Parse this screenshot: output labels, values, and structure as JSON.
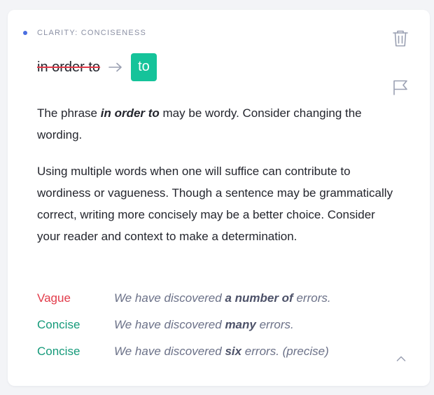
{
  "card": {
    "category": "CLARITY: CONCISENESS",
    "original_phrase": "in order to",
    "replacement": "to",
    "explanation": {
      "p1_before": "The phrase ",
      "p1_emph": "in order to",
      "p1_after": " may be wordy. Consider changing the wording.",
      "p2": "Using multiple words when one will suffice can contribute to wordiness or vagueness. Though a sentence may be grammatically correct, writing more concisely may be a better choice. Consider your reader and context to make a determination."
    },
    "examples": [
      {
        "label": "Vague",
        "before": "We have discovered ",
        "bold": "a number of",
        "after": " errors."
      },
      {
        "label": "Concise",
        "before": "We have discovered ",
        "bold": "many",
        "after": " errors."
      },
      {
        "label": "Concise",
        "before": "We have discovered ",
        "bold": "six",
        "after": " errors. (precise)"
      }
    ]
  },
  "icons": {
    "trash": "trash-icon",
    "flag": "flag-icon",
    "arrow": "arrow-right-icon",
    "collapse": "chevron-up-icon"
  },
  "colors": {
    "accent_dot": "#4a6ee0",
    "replacement_bg": "#15c39a",
    "vague": "#e23b4a",
    "concise": "#159a7a"
  }
}
